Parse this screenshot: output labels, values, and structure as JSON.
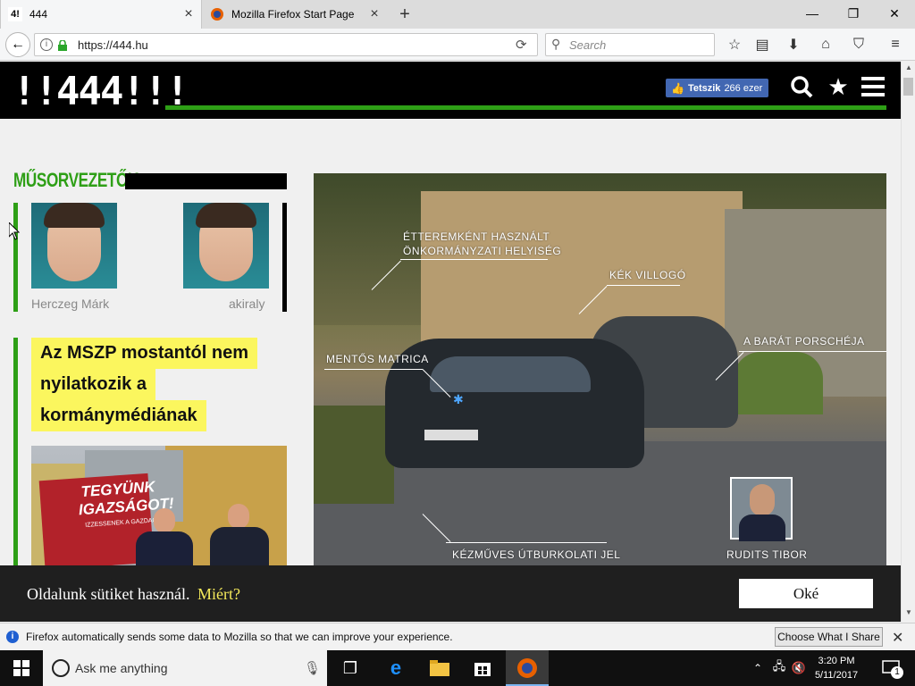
{
  "browser": {
    "tabs": [
      {
        "title": "444",
        "favicon": "444-favicon",
        "active": true
      },
      {
        "title": "Mozilla Firefox Start Page",
        "favicon": "firefox-favicon",
        "active": false
      }
    ],
    "new_tab_symbol": "+",
    "url": "https://444.hu",
    "search_placeholder": "Search",
    "window_controls": {
      "minimize": "—",
      "restore": "❐",
      "close": "✕"
    }
  },
  "site": {
    "logo": "!!444!!!",
    "fb_like_label": "Tetszik",
    "fb_like_count": "266 ezer",
    "accent_color": "#2e9f16",
    "highlight_color": "#fbf65e"
  },
  "hosts_section": {
    "title": "MŰSORVEZETŐK",
    "hosts": [
      {
        "name": "Herczeg Márk"
      },
      {
        "name": "akiraly"
      }
    ]
  },
  "featured_article": {
    "headline_lines": [
      "Az MSZP mostantól nem",
      "nyilatkozik a",
      "kormánymédiának"
    ],
    "billboard_lines": [
      "TEGYÜNK",
      "IGAZSÁGOT!",
      "IZZESSENEK A GAZDAG"
    ]
  },
  "hero_image": {
    "labels": {
      "restaurant_line1": "ÉTTEREMKÉNT HASZNÁLT",
      "restaurant_line2": "ÖNKORMÁNYZATI HELYISÉG",
      "blue_light": "KÉK VILLOGÓ",
      "porsche": "A BARÁT PORSCHÉJA",
      "ambulance_sticker": "MENTŐS MATRICA",
      "pavement": "KÉZMŰVES ÚTBURKOLATI JEL",
      "person": "RUDITS TIBOR"
    }
  },
  "cookie_bar": {
    "text": "Oldalunk sütiket használ.",
    "why_link": "Miért?",
    "ok_button": "Oké"
  },
  "notification": {
    "text": "Firefox automatically sends some data to Mozilla so that we can improve your experience.",
    "button": "Choose What I Share"
  },
  "taskbar": {
    "search_placeholder": "Ask me anything",
    "time": "3:20 PM",
    "date": "5/11/2017",
    "notification_count": "1"
  }
}
